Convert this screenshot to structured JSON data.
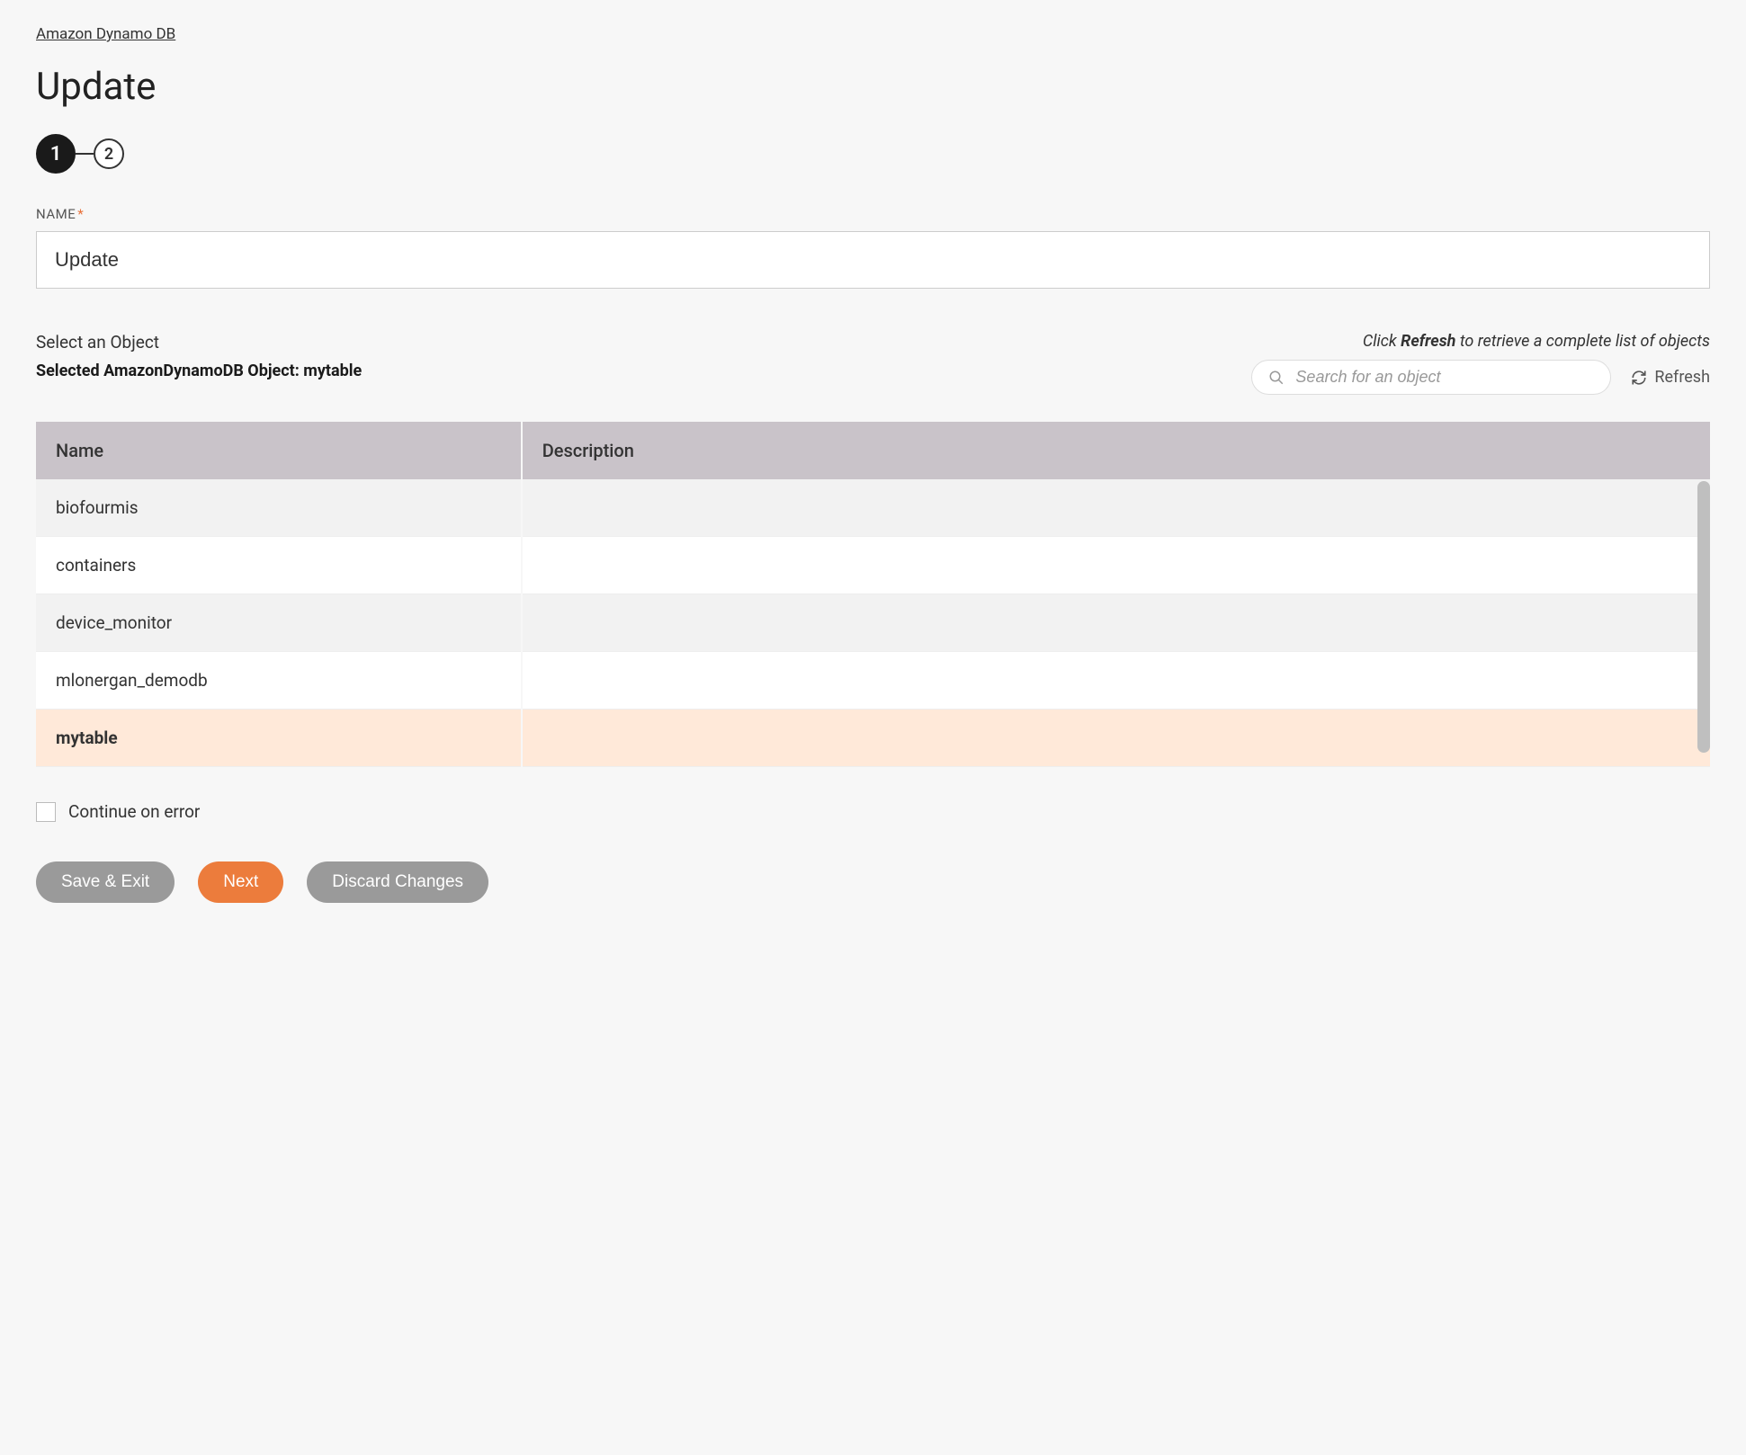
{
  "breadcrumb": "Amazon Dynamo DB",
  "page_title": "Update",
  "stepper": {
    "active": "1",
    "inactive": "2"
  },
  "name_field": {
    "label": "NAME",
    "value": "Update"
  },
  "object_section": {
    "select_label": "Select an Object",
    "selected_text": "Selected AmazonDynamoDB Object: mytable",
    "hint_prefix": "Click ",
    "hint_bold": "Refresh",
    "hint_suffix": " to retrieve a complete list of objects",
    "search_placeholder": "Search for an object",
    "refresh_label": "Refresh"
  },
  "table": {
    "headers": {
      "name": "Name",
      "description": "Description"
    },
    "rows": [
      {
        "name": "biofourmis",
        "description": "",
        "selected": false,
        "stripe": "even"
      },
      {
        "name": "containers",
        "description": "",
        "selected": false,
        "stripe": "odd"
      },
      {
        "name": "device_monitor",
        "description": "",
        "selected": false,
        "stripe": "even"
      },
      {
        "name": "mlonergan_demodb",
        "description": "",
        "selected": false,
        "stripe": "odd"
      },
      {
        "name": "mytable",
        "description": "",
        "selected": true,
        "stripe": "even"
      }
    ]
  },
  "continue_on_error_label": "Continue on error",
  "buttons": {
    "save_exit": "Save & Exit",
    "next": "Next",
    "discard": "Discard Changes"
  }
}
